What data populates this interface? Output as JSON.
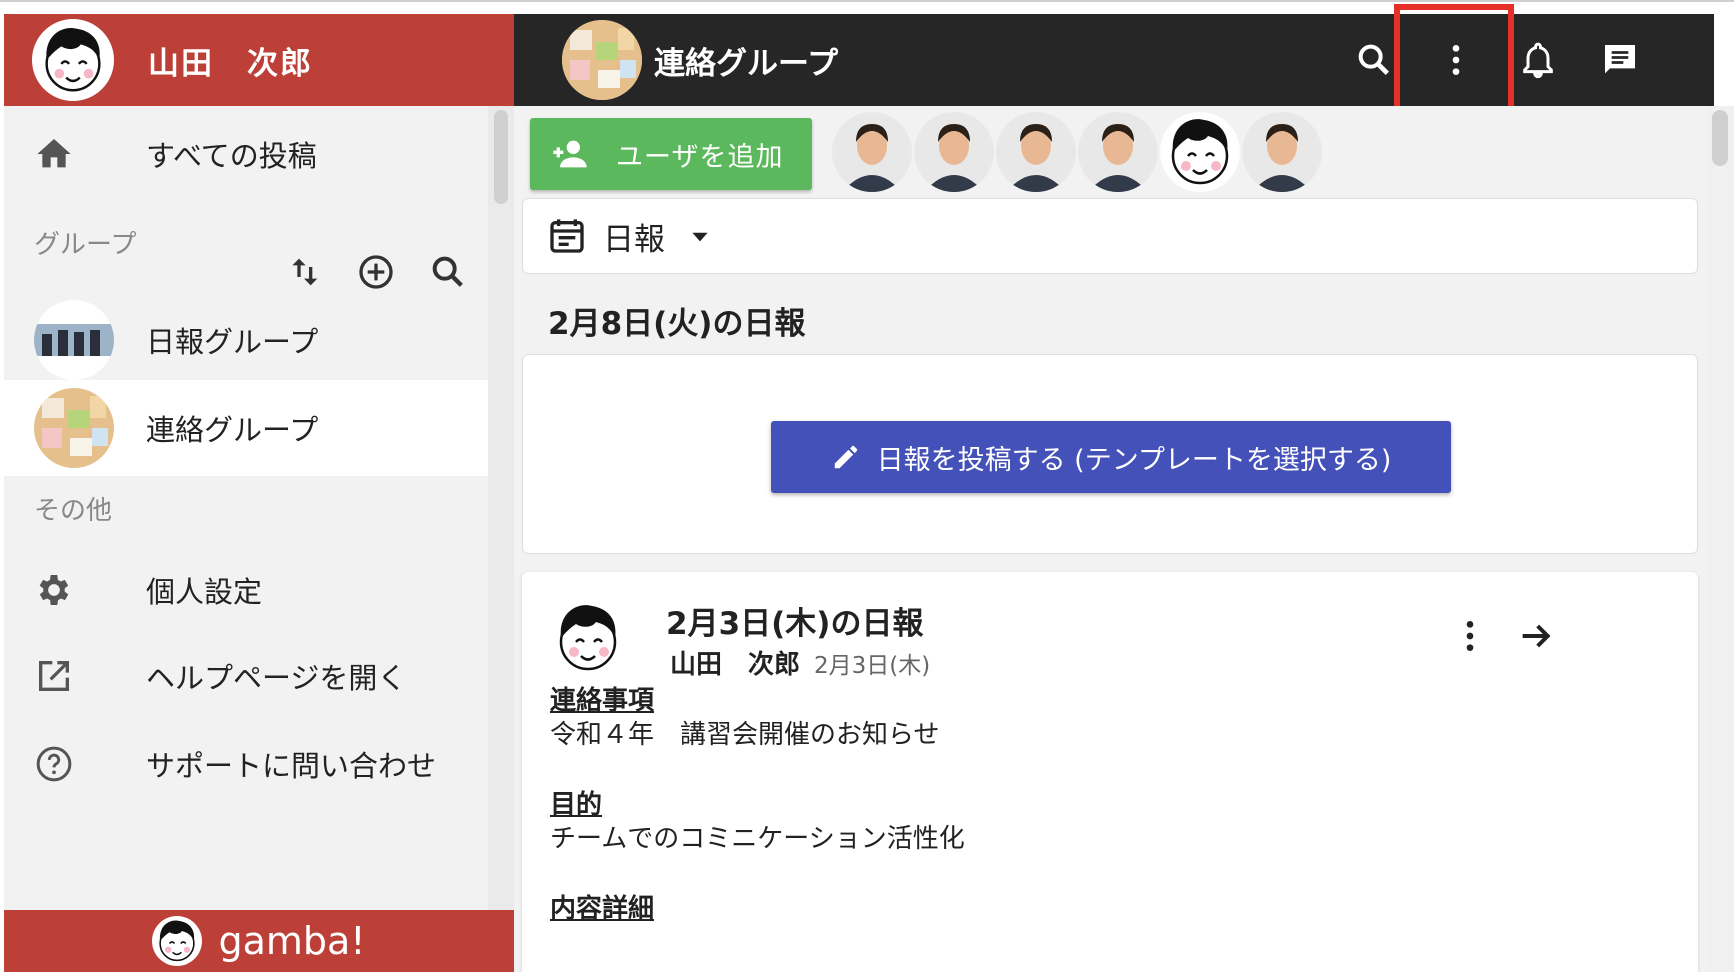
{
  "user": {
    "name": "山田　次郎"
  },
  "sidebar": {
    "all_posts": "すべての投稿",
    "groups_label": "グループ",
    "groups": [
      {
        "name": "日報グループ"
      },
      {
        "name": "連絡グループ"
      }
    ],
    "other_label": "その他",
    "other_items": [
      {
        "label": "個人設定"
      },
      {
        "label": "ヘルプページを開く"
      },
      {
        "label": "サポートに問い合わせ"
      }
    ],
    "brand": "gamba!"
  },
  "header": {
    "group_title": "連絡グループ"
  },
  "main": {
    "add_user_label": "ユーザを追加",
    "template_selector": "日報",
    "date_heading": "2月8日(火)の日報",
    "post_button": "日報を投稿する (テンプレートを選択する)",
    "report": {
      "title": "2月3日(木)の日報",
      "author": "山田　次郎",
      "date": "2月3日(木)",
      "sections": [
        {
          "heading": "連絡事項",
          "text": "令和４年　講習会開催のお知らせ"
        },
        {
          "heading": "目的",
          "text": "チームでのコミニケーション活性化"
        },
        {
          "heading": "内容詳細",
          "text": ""
        }
      ]
    }
  },
  "colors": {
    "brand_red": "#bd4038",
    "topbar": "#262626",
    "green": "#5cb85c",
    "indigo": "#4451b8",
    "highlight": "#e53027"
  }
}
